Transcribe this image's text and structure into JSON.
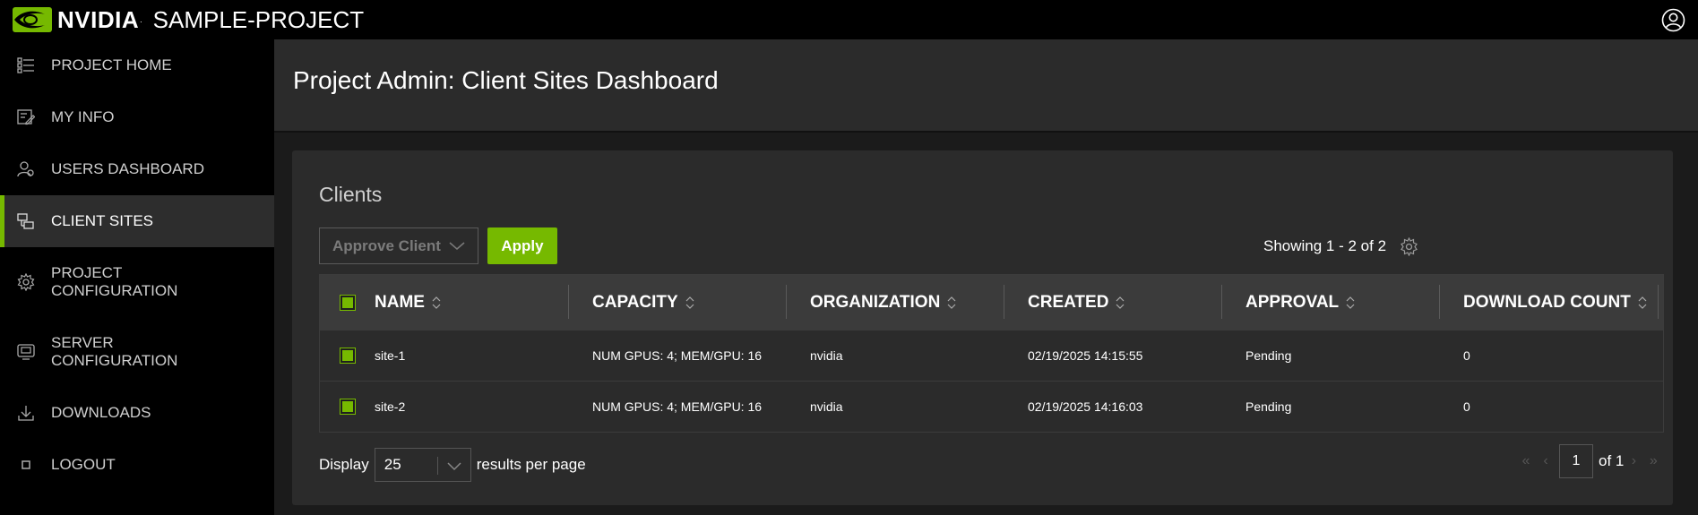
{
  "header": {
    "brand": "NVIDIA",
    "project": "SAMPLE-PROJECT"
  },
  "sidebar": {
    "items": [
      {
        "label": "PROJECT HOME",
        "icon": "list-icon"
      },
      {
        "label": "MY INFO",
        "icon": "edit-profile-icon"
      },
      {
        "label": "USERS DASHBOARD",
        "icon": "users-icon"
      },
      {
        "label": "CLIENT SITES",
        "icon": "client-sites-icon",
        "active": true
      },
      {
        "label": "PROJECT CONFIGURATION",
        "icon": "gear-icon"
      },
      {
        "label": "SERVER CONFIGURATION",
        "icon": "server-icon"
      },
      {
        "label": "DOWNLOADS",
        "icon": "download-icon"
      },
      {
        "label": "LOGOUT",
        "icon": "square-icon"
      }
    ]
  },
  "page": {
    "title": "Project Admin: Client Sites Dashboard"
  },
  "clients": {
    "title": "Clients",
    "action_select": "Approve Client",
    "apply_label": "Apply",
    "showing": "Showing 1 - 2 of 2",
    "columns": [
      "NAME",
      "CAPACITY",
      "ORGANIZATION",
      "CREATED",
      "APPROVAL",
      "DOWNLOAD COUNT"
    ],
    "rows": [
      {
        "name": "site-1",
        "capacity": "NUM GPUS: 4; MEM/GPU: 16",
        "organization": "nvidia",
        "created": "02/19/2025 14:15:55",
        "approval": "Pending",
        "download_count": "0"
      },
      {
        "name": "site-2",
        "capacity": "NUM GPUS: 4; MEM/GPU: 16",
        "organization": "nvidia",
        "created": "02/19/2025 14:16:03",
        "approval": "Pending",
        "download_count": "0"
      }
    ],
    "footer": {
      "display_label": "Display",
      "per_page": "25",
      "per_page_suffix": "results per page",
      "page": "1",
      "of_label": "of 1"
    }
  },
  "colors": {
    "accent": "#76b900",
    "background": "#1b1b1b",
    "panel": "#2b2b2b"
  }
}
